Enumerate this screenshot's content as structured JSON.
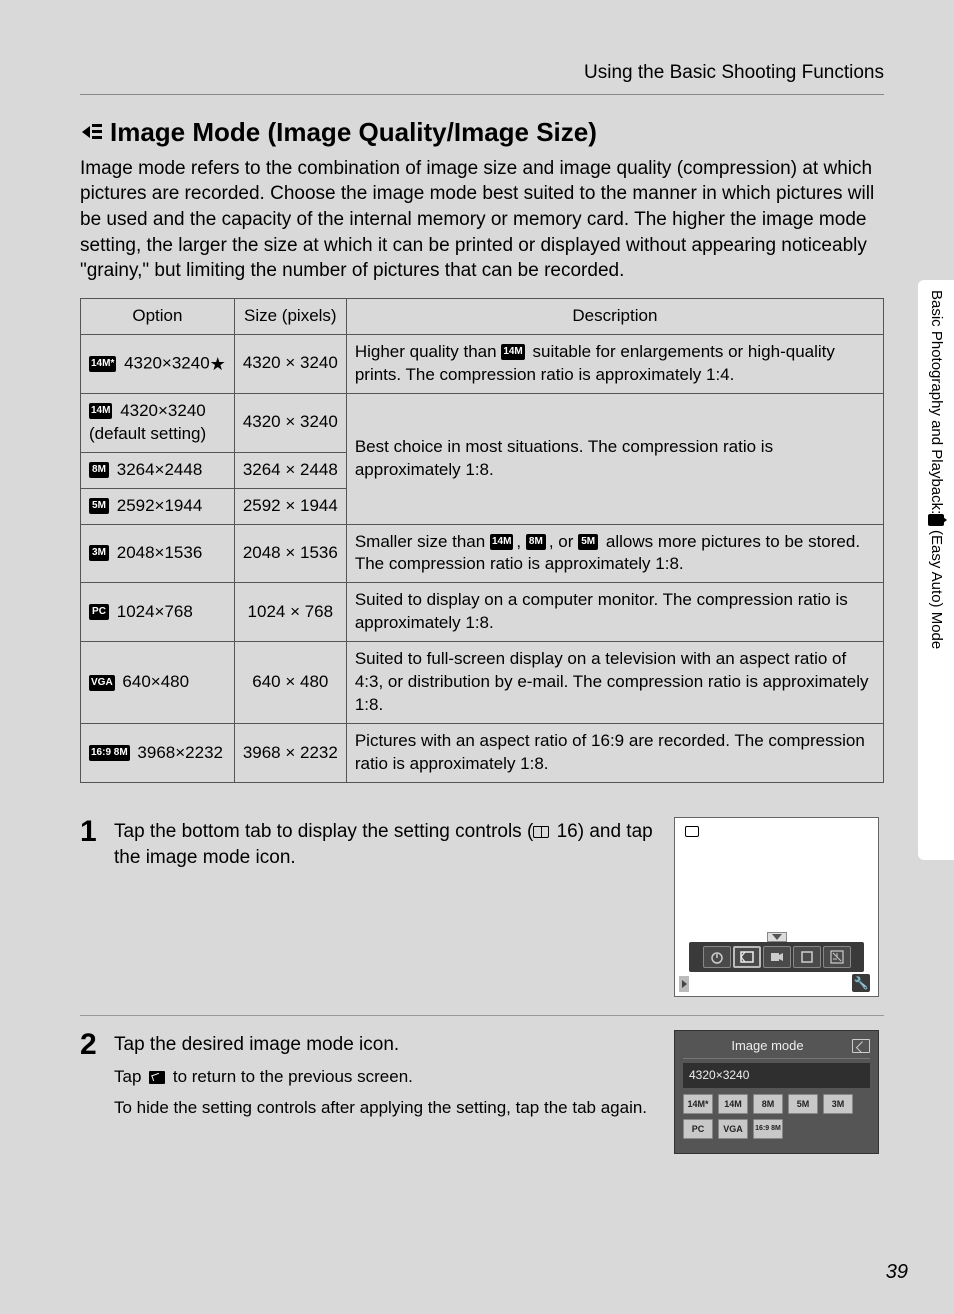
{
  "header": {
    "chapter": "Using the Basic Shooting Functions"
  },
  "title": "Image Mode (Image Quality/Image Size)",
  "intro": "Image mode refers to the combination of image size and image quality (compression) at which pictures are recorded. Choose the image mode best suited to the manner in which pictures will be used and the capacity of the internal memory or memory card. The higher the image mode setting, the larger the size at which it can be printed or displayed without appearing noticeably \"grainy,\" but limiting the number of pictures that can be recorded.",
  "table": {
    "headers": {
      "option": "Option",
      "size": "Size (pixels)",
      "desc": "Description"
    },
    "rows": [
      {
        "icon": "14M*",
        "opt": "4320×3240",
        "star": "★",
        "size": "4320 × 3240",
        "desc_pre": "Higher quality than ",
        "desc_badge": "14M",
        "desc_post": " suitable for enlargements or high-quality prints. The compression ratio is approximately 1:4."
      },
      {
        "icon": "14M",
        "opt": "4320×3240",
        "note": "(default setting)",
        "size": "4320 × 3240",
        "grp": "g18"
      },
      {
        "icon": "8M",
        "opt": "3264×2448",
        "size": "3264 × 2448",
        "grp": "g18"
      },
      {
        "icon": "5M",
        "opt": "2592×1944",
        "size": "2592 × 1944",
        "grp": "g18"
      },
      {
        "icon": "3M",
        "opt": "2048×1536",
        "size": "2048 × 1536",
        "desc_pre": "Smaller size than ",
        "desc_badges": [
          "14M",
          "8M",
          "5M"
        ],
        "desc_post": " allows more pictures to be stored. The compression ratio is approximately 1:8."
      },
      {
        "icon": "PC",
        "opt": "1024×768",
        "size": "1024 × 768",
        "desc": "Suited to display on a computer monitor. The compression ratio is approximately 1:8."
      },
      {
        "icon": "VGA",
        "opt": "640×480",
        "size": "640 × 480",
        "desc": "Suited to full-screen display on a television with an aspect ratio of 4:3, or distribution by e-mail. The compression ratio is approximately 1:8."
      },
      {
        "icon": "16:9 8M",
        "opt": "3968×2232",
        "size": "3968 × 2232",
        "desc": "Pictures with an aspect ratio of 16:9 are recorded. The compression ratio is approximately 1:8."
      }
    ],
    "group_desc": {
      "g18": "Best choice in most situations. The compression ratio is approximately 1:8."
    }
  },
  "steps": [
    {
      "num": "1",
      "heading_a": "Tap the bottom tab to display the setting controls (",
      "heading_ref": "16",
      "heading_b": ") and tap the image mode icon.",
      "fig": "controls"
    },
    {
      "num": "2",
      "heading": "Tap the desired image mode icon.",
      "line1_a": "Tap ",
      "line1_b": " to return to the previous screen.",
      "line2": "To hide the setting controls after applying the setting, tap the tab again.",
      "fig": "modes",
      "fig_title": "Image mode",
      "fig_size": "4320×3240",
      "fig_opts": [
        "14M*",
        "14M",
        "8M",
        "5M",
        "3M",
        "PC",
        "VGA",
        "16:9 8M"
      ]
    }
  ],
  "sidebar": {
    "text_a": "Basic Photography and Playback: ",
    "text_b": " (Easy Auto) Mode"
  },
  "page_number": "39"
}
